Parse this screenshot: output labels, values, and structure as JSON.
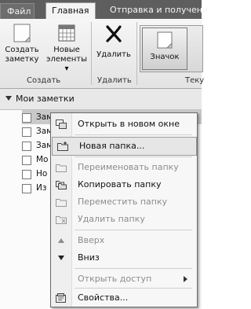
{
  "tabs": {
    "file": "Файл",
    "home": "Главная",
    "send": "Отправка и получени"
  },
  "ribbon": {
    "create_note": [
      "Создать",
      "заметку"
    ],
    "new_items": [
      "Новые",
      "элементы ▾"
    ],
    "delete": "Удалить",
    "view_note": "Значок",
    "group_create": "Создать",
    "group_delete": "Удалить",
    "group_current": "Теку"
  },
  "pane": {
    "title": "Мои заметки",
    "notes": [
      "Зам",
      "Зам",
      "Зам",
      "Мо",
      "Но",
      "Из"
    ]
  },
  "context_menu": {
    "items": [
      {
        "label": "Открыть в новом окне",
        "icon": "open-window-icon",
        "enabled": true
      },
      {
        "label": "Новая папка...",
        "icon": "new-folder-icon",
        "enabled": true,
        "highlighted": true
      },
      {
        "label": "Переименовать папку",
        "icon": "rename-folder-icon",
        "enabled": false
      },
      {
        "label": "Копировать папку",
        "icon": "copy-folder-icon",
        "enabled": true
      },
      {
        "label": "Переместить папку",
        "icon": "move-folder-icon",
        "enabled": false
      },
      {
        "label": "Удалить папку",
        "icon": "delete-folder-icon",
        "enabled": false
      },
      {
        "label": "Вверх",
        "icon": "up-arrow-icon",
        "enabled": false
      },
      {
        "label": "Вниз",
        "icon": "down-arrow-icon",
        "enabled": true
      },
      {
        "label": "Открыть доступ",
        "icon": "share-icon",
        "enabled": false,
        "submenu": true
      },
      {
        "label": "Свойства...",
        "icon": "properties-icon",
        "enabled": true
      }
    ]
  }
}
